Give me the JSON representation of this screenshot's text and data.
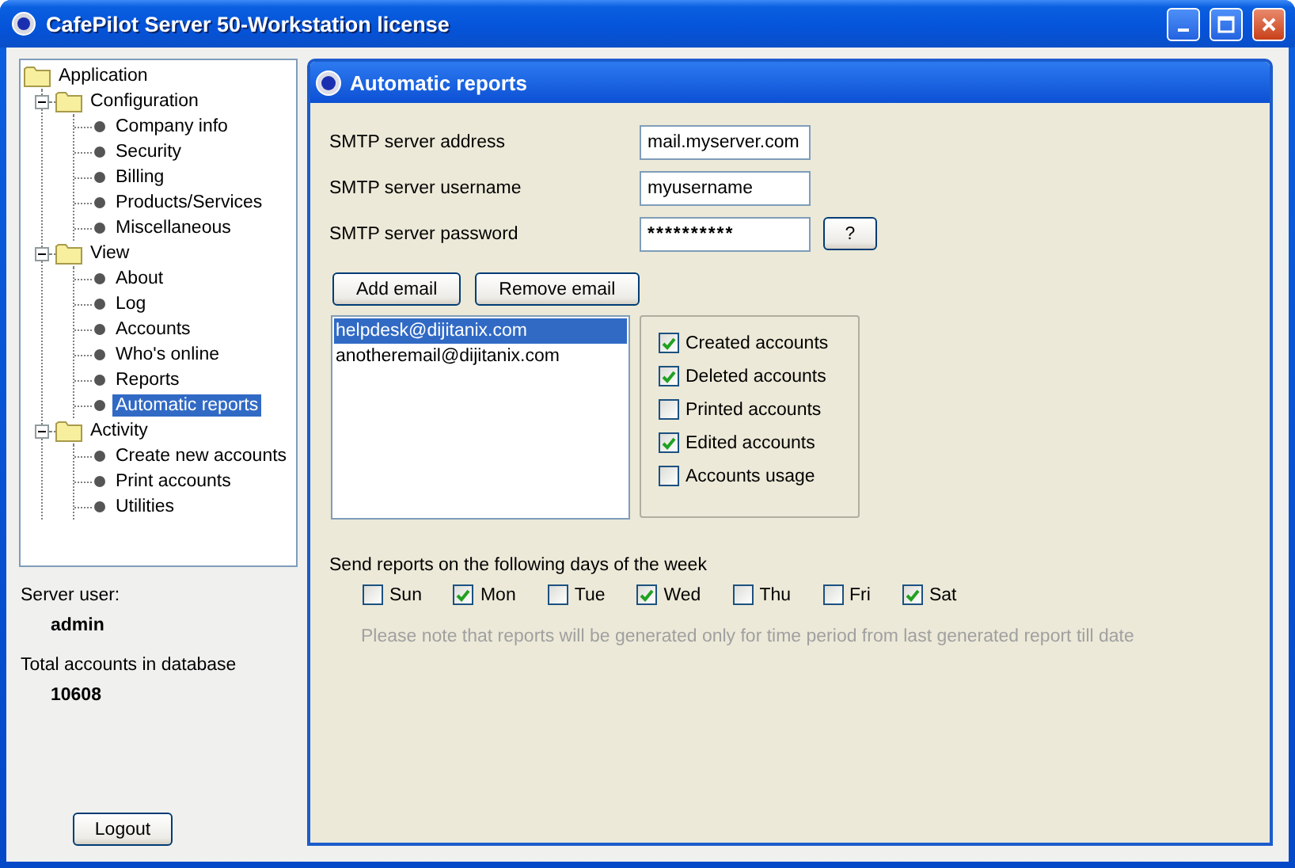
{
  "window": {
    "title": "CafePilot Server 50-Workstation license"
  },
  "tree": [
    {
      "label": "Application",
      "selected": false,
      "children": [
        {
          "label": "Configuration",
          "selected": false,
          "expanded": true,
          "children": [
            {
              "label": "Company info",
              "selected": false
            },
            {
              "label": "Security",
              "selected": false
            },
            {
              "label": "Billing",
              "selected": false
            },
            {
              "label": "Products/Services",
              "selected": false
            },
            {
              "label": "Miscellaneous",
              "selected": false
            }
          ]
        },
        {
          "label": "View",
          "selected": false,
          "expanded": true,
          "children": [
            {
              "label": "About",
              "selected": false
            },
            {
              "label": "Log",
              "selected": false
            },
            {
              "label": "Accounts",
              "selected": false
            },
            {
              "label": "Who's online",
              "selected": false
            },
            {
              "label": "Reports",
              "selected": false
            },
            {
              "label": "Automatic reports",
              "selected": true
            }
          ]
        },
        {
          "label": "Activity",
          "selected": false,
          "expanded": true,
          "children": [
            {
              "label": "Create new accounts",
              "selected": false
            },
            {
              "label": "Print accounts",
              "selected": false
            },
            {
              "label": "Utilities",
              "selected": false
            }
          ]
        }
      ]
    }
  ],
  "session": {
    "user_label": "Server user:",
    "user": "admin",
    "total_label": "Total accounts in database",
    "total": "10608",
    "logout": "Logout"
  },
  "panel": {
    "title": "Automatic reports",
    "fields": [
      {
        "label": "SMTP server address",
        "value": "mail.myserver.com",
        "kind": "text"
      },
      {
        "label": "SMTP server username",
        "value": "myusername",
        "kind": "text"
      },
      {
        "label": "SMTP server password",
        "value": "**********",
        "kind": "password",
        "button": "?"
      }
    ],
    "buttons": [
      "Add email",
      "Remove email"
    ],
    "emails": [
      {
        "address": "helpdesk@dijitanix.com",
        "selected": true
      },
      {
        "address": "anotheremail@dijitanix.com",
        "selected": false
      }
    ],
    "report_options": [
      {
        "label": "Created accounts",
        "checked": true
      },
      {
        "label": "Deleted accounts",
        "checked": true
      },
      {
        "label": "Printed accounts",
        "checked": false
      },
      {
        "label": "Edited accounts",
        "checked": true
      },
      {
        "label": "Accounts usage",
        "checked": false
      }
    ],
    "days_label": "Send reports on the following days of the week",
    "days": [
      {
        "label": "Sun",
        "checked": false
      },
      {
        "label": "Mon",
        "checked": true
      },
      {
        "label": "Tue",
        "checked": false
      },
      {
        "label": "Wed",
        "checked": true
      },
      {
        "label": "Thu",
        "checked": false
      },
      {
        "label": "Fri",
        "checked": false
      },
      {
        "label": "Sat",
        "checked": true
      }
    ],
    "note": "Please note that reports will be generated only for time period from last generated report till date"
  }
}
